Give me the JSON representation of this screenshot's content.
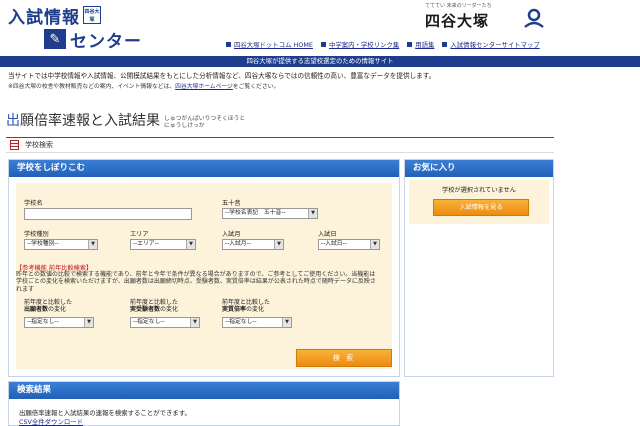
{
  "header": {
    "logo_title": "入試情報",
    "logo_badge": "四谷大塚",
    "logo_sub": "センター",
    "brand_tagline": "てててい 未来のリーダーたち",
    "brand_name": "四谷大塚",
    "nav": [
      {
        "label": "四谷大塚ドットコム HOME"
      },
      {
        "label": "中学案内・学校リンク集"
      },
      {
        "label": "用語集"
      },
      {
        "label": "入試情報センターサイトマップ"
      }
    ]
  },
  "banner": "四谷大塚が提供する志望校選定のための情報サイト",
  "intro": {
    "line1": "当サイトでは中学校情報や入試情報、公開模試結果をもとにした分析情報など、四谷大塚ならではの信頼性の高い、豊富なデータを提供します。",
    "line2_prefix": "※四谷大塚の校舎や教材販売などの案内、イベント情報などは、",
    "line2_link": "四谷大塚ホームページ",
    "line2_suffix": "をご覧ください。"
  },
  "page_title": {
    "first_char": "出",
    "rest": "願倍率速報と入試結果",
    "ruby_line1": "しゅつがんばいりつそくほうと",
    "ruby_line2": "にゅうしけっか"
  },
  "search_section": {
    "label": "学校検索"
  },
  "filter_panel": {
    "title": "学校をしぼりこむ",
    "school_name_label": "学校名",
    "school_name_value": "",
    "gojuon_label": "五十音",
    "gojuon_value": "--学校名表記　五十音--",
    "school_type_label": "学校種別",
    "school_type_value": "--学校種別--",
    "area_label": "エリア",
    "area_value": "--エリア--",
    "exam_month_label": "入試月",
    "exam_month_value": "--入試月--",
    "exam_day_label": "入試日",
    "exam_day_value": "--入試日--",
    "note_heading": "【参考機能 前年比較検索】",
    "note_body": "昨年との数値の比較で検索する機能であり、前年と今年で条件が異なる場合がありますので、ご参考としてご使用ください。当機能は学校ごとの変化を検索いただけますが、出願者数は出願締切時点、受験者数、実質倍率は結果が公表された時点で随時データに反映されます",
    "cmp1_prefix": "前年度と比較した",
    "cmp1_bold": "出願者数",
    "cmp1_suffix": "の変化",
    "cmp1_value": "--指定なし--",
    "cmp2_prefix": "前年度と比較した",
    "cmp2_bold": "実受験者数",
    "cmp2_suffix": "の変化",
    "cmp2_value": "--指定なし--",
    "cmp3_prefix": "前年度と比較した",
    "cmp3_bold": "実質倍率",
    "cmp3_suffix": "の変化",
    "cmp3_value": "--指定なし--",
    "search_button": "検 索"
  },
  "favorites": {
    "title": "お気に入り",
    "empty_text": "学校が選択されていません",
    "button": "入試情報を見る"
  },
  "results": {
    "title": "検索結果",
    "text": "出願倍率速報と入試結果の速報を検索することができます。",
    "csv_link": "CSV全件ダウンロード"
  },
  "colors": {
    "brand_navy": "#1f3d8c",
    "panel_blue": "#2260b8",
    "form_beige": "#fdf3da",
    "button_orange": "#ee8a10",
    "note_red": "#c0121b"
  }
}
